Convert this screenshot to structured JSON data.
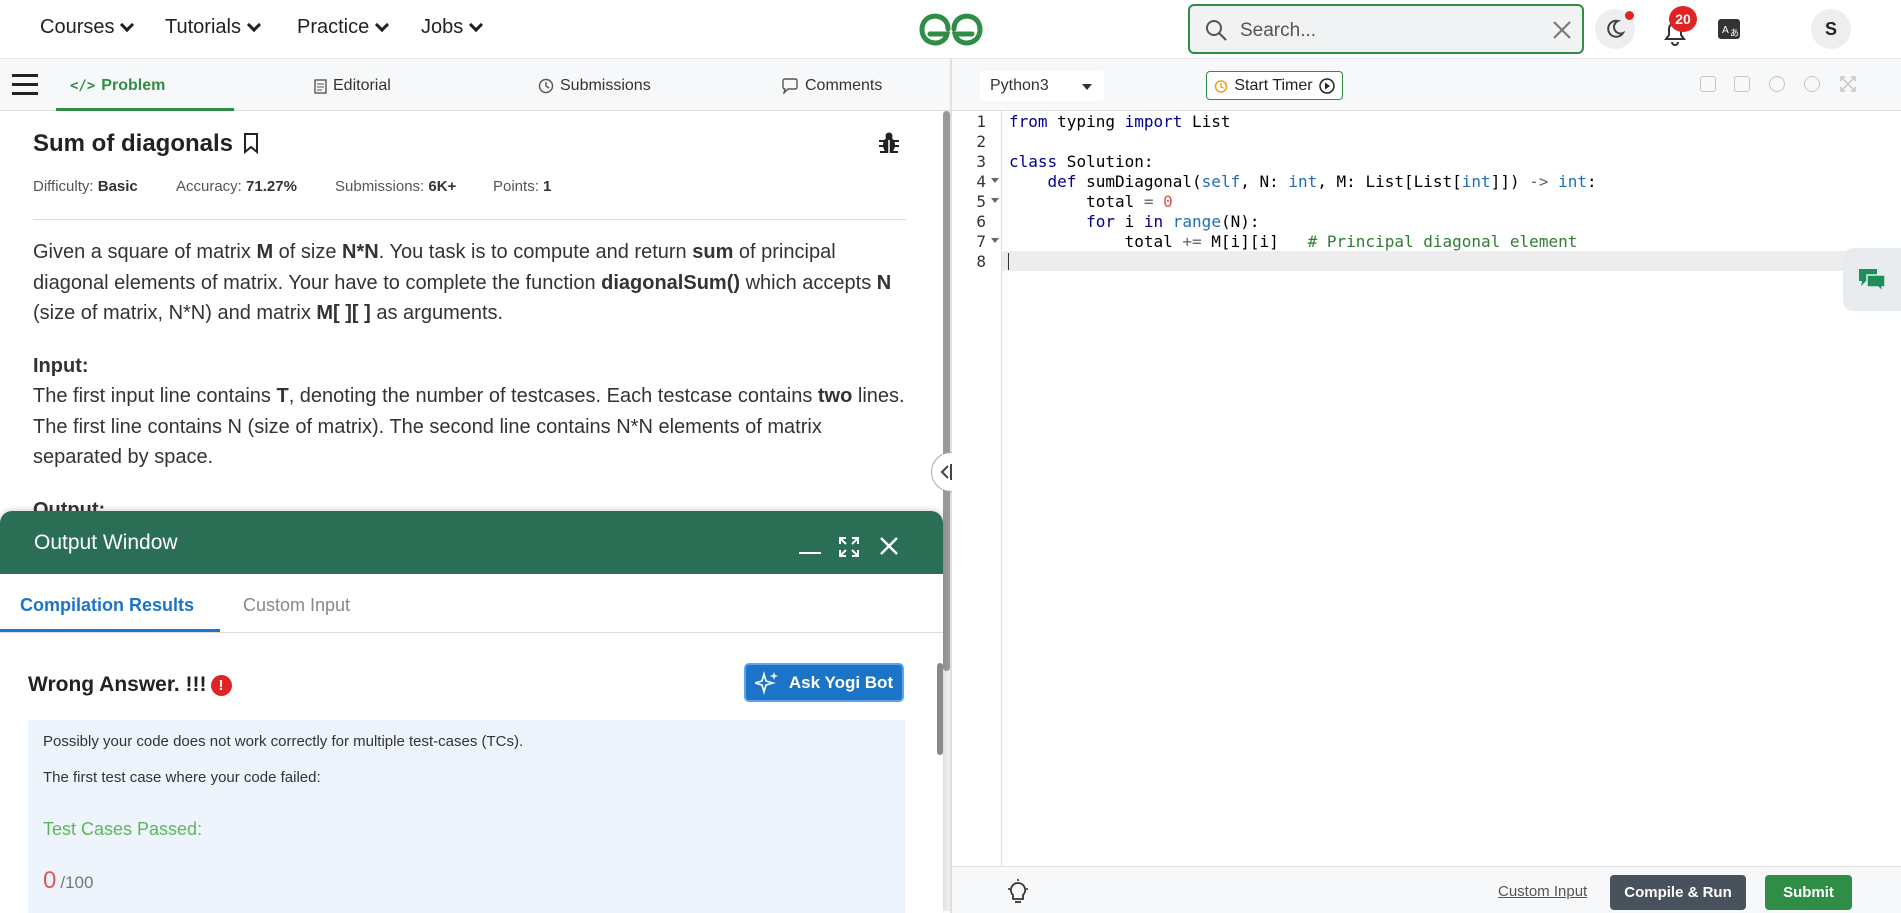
{
  "nav": {
    "items": [
      "Courses",
      "Tutorials",
      "Practice",
      "Jobs"
    ],
    "search_placeholder": "Search...",
    "notification_count": "20",
    "avatar_initial": "S"
  },
  "tabs": {
    "problem": "Problem",
    "editorial": "Editorial",
    "submissions": "Submissions",
    "comments": "Comments"
  },
  "problem": {
    "title": "Sum of diagonals",
    "difficulty_label": "Difficulty:",
    "difficulty": "Basic",
    "accuracy_label": "Accuracy:",
    "accuracy": "71.27%",
    "submissions_label": "Submissions:",
    "submissions": "6K+",
    "points_label": "Points:",
    "points": "1",
    "description": {
      "t1": "Given a square of matrix ",
      "b1": "M",
      "t2": " of size ",
      "b2": "N*N",
      "t3": ". You task is to compute and return ",
      "b3": "sum",
      "t4": " of principal diagonal elements of matrix. Your have to complete the function ",
      "b4": "diagonalSum()",
      "t5": " which accepts ",
      "b5": "N",
      "t6": " (size of matrix, N*N) and matrix ",
      "b6": "M[ ][ ]",
      "t7": " as arguments."
    },
    "input_heading": "Input:",
    "input": {
      "t1": "The first input line contains ",
      "b1": "T",
      "t2": ", denoting the number of testcases. Each testcase contains ",
      "b2": "two",
      "t3": " lines. The first line contains N (size of matrix). The second line contains N*N elements of matrix separated by space."
    },
    "output_heading": "Output:"
  },
  "output_window": {
    "title": "Output Window",
    "tab_results": "Compilation Results",
    "tab_custom": "Custom Input",
    "verdict": "Wrong Answer. !!!",
    "ask_button": "Ask Yogi Bot",
    "msg1": "Possibly your code does not work correctly for multiple test-cases (TCs).",
    "msg2": "The first test case where your code failed:",
    "passed_label": "Test Cases Passed:",
    "passed": "0",
    "total": "/100"
  },
  "editor": {
    "language": "Python3",
    "timer_label": "Start Timer",
    "line_numbers": [
      "1",
      "2",
      "3",
      "4",
      "5",
      "6",
      "7",
      "8"
    ],
    "code": {
      "l1a": "from",
      "l1b": " typing ",
      "l1c": "import",
      "l1d": " List",
      "l3a": "class",
      "l3b": " Solution:",
      "l4a": "    ",
      "l4b": "def",
      "l4c": " sumDiagonal(",
      "l4d": "self",
      "l4e": ", N: ",
      "l4f": "int",
      "l4g": ", M: List[List[",
      "l4h": "int",
      "l4i": "]]) ",
      "l4j": "->",
      "l4k": " ",
      "l4l": "int",
      "l4m": ":",
      "l5a": "        total ",
      "l5b": "=",
      "l5c": " ",
      "l5d": "0",
      "l6a": "        ",
      "l6b": "for",
      "l6c": " i ",
      "l6d": "in",
      "l6e": " ",
      "l6f": "range",
      "l6g": "(N):",
      "l7a": "            total ",
      "l7b": "+=",
      "l7c": " M[i][i]   ",
      "l7d": "# Principal diagonal element"
    },
    "custom_input": "Custom Input",
    "compile_run": "Compile & Run",
    "submit": "Submit"
  },
  "colors": {
    "brand_green": "#2f8d46",
    "header_green": "#2a6e56",
    "accent_blue": "#1b74c8",
    "error_red": "#e02424"
  }
}
